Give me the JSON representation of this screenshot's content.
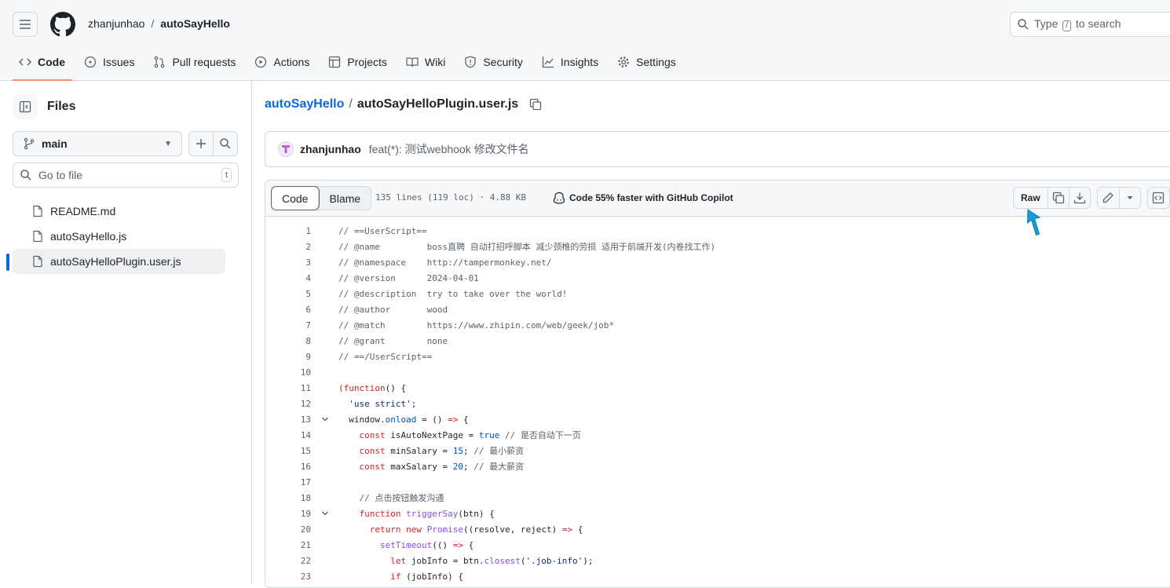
{
  "header": {
    "owner": "zhanjunhao",
    "separator": "/",
    "repo": "autoSayHello",
    "search_prefix": "Type",
    "search_key": "/",
    "search_suffix": "to search"
  },
  "tabs": [
    {
      "label": "Code",
      "icon": "code-icon",
      "active": true
    },
    {
      "label": "Issues",
      "icon": "issue-icon"
    },
    {
      "label": "Pull requests",
      "icon": "pull-request-icon"
    },
    {
      "label": "Actions",
      "icon": "play-icon"
    },
    {
      "label": "Projects",
      "icon": "table-icon"
    },
    {
      "label": "Wiki",
      "icon": "book-icon"
    },
    {
      "label": "Security",
      "icon": "shield-icon"
    },
    {
      "label": "Insights",
      "icon": "graph-icon"
    },
    {
      "label": "Settings",
      "icon": "gear-icon"
    }
  ],
  "sidebar": {
    "title": "Files",
    "branch": "main",
    "goto_placeholder": "Go to file",
    "goto_shortcut": "t",
    "files": [
      {
        "name": "README.md",
        "selected": false
      },
      {
        "name": "autoSayHello.js",
        "selected": false
      },
      {
        "name": "autoSayHelloPlugin.user.js",
        "selected": true
      }
    ]
  },
  "path": {
    "repo": "autoSayHello",
    "separator": "/",
    "file": "autoSayHelloPlugin.user.js"
  },
  "commit": {
    "author": "zhanjunhao",
    "message": "feat(*): 测试webhook 修改文件名"
  },
  "file_header": {
    "code_tab": "Code",
    "blame_tab": "Blame",
    "meta": "135 lines (119 loc) · 4.88 KB",
    "copilot": "Code 55% faster with GitHub Copilot",
    "raw": "Raw"
  },
  "accent_color": "#0969da",
  "tab_underline_color": "#fd8c73",
  "code": [
    {
      "n": "1",
      "fold": false,
      "tokens": [
        [
          "c",
          "// ==UserScript=="
        ]
      ]
    },
    {
      "n": "2",
      "fold": false,
      "tokens": [
        [
          "c",
          "// @name         boss直聘 自动打招呼脚本 减少颈椎的劳损 适用于前端开发(内卷找工作)"
        ]
      ]
    },
    {
      "n": "3",
      "fold": false,
      "tokens": [
        [
          "c",
          "// @namespace    http://tampermonkey.net/"
        ]
      ]
    },
    {
      "n": "4",
      "fold": false,
      "tokens": [
        [
          "c",
          "// @version      2024-04-01"
        ]
      ]
    },
    {
      "n": "5",
      "fold": false,
      "tokens": [
        [
          "c",
          "// @description  try to take over the world!"
        ]
      ]
    },
    {
      "n": "6",
      "fold": false,
      "tokens": [
        [
          "c",
          "// @author       wood"
        ]
      ]
    },
    {
      "n": "7",
      "fold": false,
      "tokens": [
        [
          "c",
          "// @match        https://www.zhipin.com/web/geek/job*"
        ]
      ]
    },
    {
      "n": "8",
      "fold": false,
      "tokens": [
        [
          "c",
          "// @grant        none"
        ]
      ]
    },
    {
      "n": "9",
      "fold": false,
      "tokens": [
        [
          "c",
          "// ==/UserScript=="
        ]
      ]
    },
    {
      "n": "10",
      "fold": false,
      "tokens": []
    },
    {
      "n": "11",
      "fold": false,
      "tokens": [
        [
          "k",
          "(function"
        ],
        [
          "",
          "() {"
        ]
      ]
    },
    {
      "n": "12",
      "fold": false,
      "tokens": [
        [
          "",
          "  "
        ],
        [
          "s",
          "'use strict'"
        ],
        [
          "",
          ";"
        ]
      ]
    },
    {
      "n": "13",
      "fold": true,
      "tokens": [
        [
          "",
          "  window."
        ],
        [
          "p",
          "onload"
        ],
        [
          "",
          " = () "
        ],
        [
          "k",
          "=>"
        ],
        [
          "",
          " {"
        ]
      ]
    },
    {
      "n": "14",
      "fold": false,
      "tokens": [
        [
          "",
          "    "
        ],
        [
          "k",
          "const"
        ],
        [
          "",
          " isAutoNextPage = "
        ],
        [
          "p",
          "true"
        ],
        [
          "",
          " "
        ],
        [
          "c",
          "// 是否自动下一页"
        ]
      ]
    },
    {
      "n": "15",
      "fold": false,
      "tokens": [
        [
          "",
          "    "
        ],
        [
          "k",
          "const"
        ],
        [
          "",
          " minSalary = "
        ],
        [
          "p",
          "15"
        ],
        [
          "",
          "; "
        ],
        [
          "c",
          "// 最小薪资"
        ]
      ]
    },
    {
      "n": "16",
      "fold": false,
      "tokens": [
        [
          "",
          "    "
        ],
        [
          "k",
          "const"
        ],
        [
          "",
          " maxSalary = "
        ],
        [
          "p",
          "20"
        ],
        [
          "",
          "; "
        ],
        [
          "c",
          "// 最大薪资"
        ]
      ]
    },
    {
      "n": "17",
      "fold": false,
      "tokens": []
    },
    {
      "n": "18",
      "fold": false,
      "tokens": [
        [
          "",
          "    "
        ],
        [
          "c",
          "// 点击按钮触发沟通"
        ]
      ]
    },
    {
      "n": "19",
      "fold": true,
      "tokens": [
        [
          "",
          "    "
        ],
        [
          "k",
          "function"
        ],
        [
          "",
          " "
        ],
        [
          "f",
          "triggerSay"
        ],
        [
          "",
          "(btn) {"
        ]
      ]
    },
    {
      "n": "20",
      "fold": false,
      "tokens": [
        [
          "",
          "      "
        ],
        [
          "k",
          "return"
        ],
        [
          "",
          " "
        ],
        [
          "k",
          "new"
        ],
        [
          "",
          " "
        ],
        [
          "f",
          "Promise"
        ],
        [
          "",
          "((resolve, reject) "
        ],
        [
          "k",
          "=>"
        ],
        [
          "",
          " {"
        ]
      ]
    },
    {
      "n": "21",
      "fold": false,
      "tokens": [
        [
          "",
          "        "
        ],
        [
          "f",
          "setTimeout"
        ],
        [
          "",
          "(() "
        ],
        [
          "k",
          "=>"
        ],
        [
          "",
          " {"
        ]
      ]
    },
    {
      "n": "22",
      "fold": false,
      "tokens": [
        [
          "",
          "          "
        ],
        [
          "k",
          "let"
        ],
        [
          "",
          " jobInfo = btn."
        ],
        [
          "f",
          "closest"
        ],
        [
          "",
          "("
        ],
        [
          "s",
          "'.job-info'"
        ],
        [
          "",
          ");"
        ]
      ]
    },
    {
      "n": "23",
      "fold": false,
      "tokens": [
        [
          "",
          "          "
        ],
        [
          "k",
          "if"
        ],
        [
          "",
          " (jobInfo) {"
        ]
      ]
    }
  ]
}
